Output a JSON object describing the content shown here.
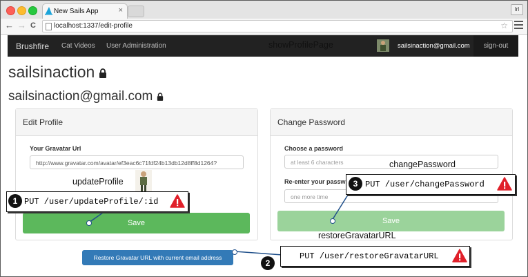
{
  "browser": {
    "tab_title": "New Sails App",
    "tab_close": "×",
    "profile_badge": "lrl",
    "url": "localhost:1337/edit-profile",
    "back": "←",
    "forward": "→",
    "reload": "C",
    "star": "☆"
  },
  "navbar": {
    "brand": "Brushfire",
    "links": [
      "Cat Videos",
      "User Administration"
    ],
    "user_email": "sailsinaction@gmail.com",
    "signout": "sign-out"
  },
  "profile": {
    "username": "sailsinaction",
    "email": "sailsinaction@gmail.com"
  },
  "edit_panel": {
    "title": "Edit Profile",
    "gravatar_label": "Your Gravatar Url",
    "gravatar_value": "http://www.gravatar.com/avatar/ef3eac6c71fdf24b13db12d8ff8d1264?",
    "save": "Save"
  },
  "password_panel": {
    "title": "Change Password",
    "choose_label": "Choose a password",
    "choose_placeholder": "at least 6 characters",
    "reenter_label": "Re-enter your passw",
    "reenter_placeholder": "one more time",
    "save": "Save"
  },
  "restore_button": "Restore Gravatar URL with current email address",
  "annotations": {
    "show_profile_page": "showProfilePage",
    "update_profile": "updateProfile",
    "change_password": "changePassword",
    "restore_gravatar_url": "restoreGravatarURL",
    "callout1": {
      "num": "1",
      "text": "PUT /user/updateProfile/:id"
    },
    "callout2": {
      "num": "2",
      "text": "PUT /user/restoreGravatarURL"
    },
    "callout3": {
      "num": "3",
      "text": "PUT /user/changePassword"
    }
  },
  "colors": {
    "navbar_bg": "#222222",
    "save_green": "#5cb85c",
    "save_green_disabled": "#9bd39b",
    "restore_blue": "#337ab7",
    "warning_red": "#e0202a"
  }
}
